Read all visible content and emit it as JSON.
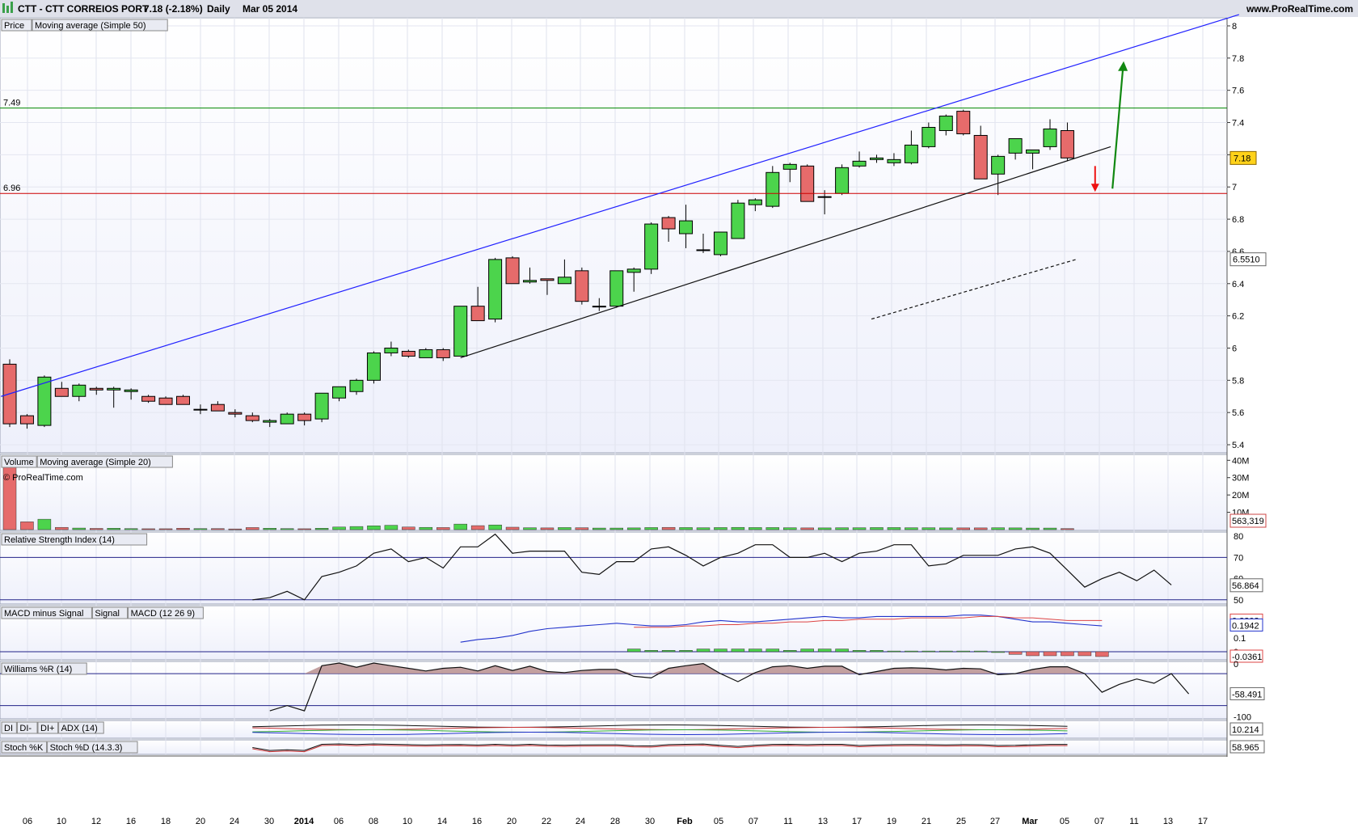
{
  "header": {
    "title": "CTT - CTT CORREIOS PORT",
    "quote": "7.18 (-2.18%)",
    "period": "Daily",
    "date": "Mar 05 2014",
    "site": "www.ProRealTime.com"
  },
  "watermark": "© ProRealTime.com",
  "colors": {
    "up": "#4cd44c",
    "down": "#e66b6b",
    "channel_upper": "#2020ff",
    "resistance": "#008800",
    "support_line": "#cc0000",
    "panel_bg": "#eef0fb"
  },
  "chart_data": [
    {
      "panel": "price",
      "type": "candlestick",
      "legend": [
        "Price",
        "Moving average (Simple 50)"
      ],
      "ylim": [
        5.38,
        8.02
      ],
      "y_ticks": [
        "5.4",
        "5.6",
        "5.8",
        "6",
        "6.2",
        "6.4",
        "6.6",
        "6.8",
        "7",
        "7.2",
        "7.4",
        "7.6",
        "7.8",
        "8"
      ],
      "last_price_label": "7.18",
      "ma_label": "6.5510",
      "levels": [
        {
          "label": "7.49",
          "value": 7.49,
          "color": "green"
        },
        {
          "label": "6.96",
          "value": 6.96,
          "color": "red"
        }
      ],
      "x_ticks": [
        "06",
        "10",
        "12",
        "16",
        "18",
        "20",
        "24",
        "30",
        "2014",
        "06",
        "08",
        "10",
        "14",
        "16",
        "20",
        "22",
        "24",
        "28",
        "30",
        "Feb",
        "05",
        "07",
        "11",
        "13",
        "17",
        "19",
        "21",
        "25",
        "27",
        "Mar",
        "05",
        "07",
        "11",
        "13",
        "17"
      ],
      "candles": [
        {
          "o": 5.9,
          "h": 5.93,
          "l": 5.51,
          "c": 5.53
        },
        {
          "o": 5.58,
          "h": 5.59,
          "l": 5.5,
          "c": 5.53
        },
        {
          "o": 5.52,
          "h": 5.83,
          "l": 5.51,
          "c": 5.82
        },
        {
          "o": 5.75,
          "h": 5.79,
          "l": 5.73,
          "c": 5.7
        },
        {
          "o": 5.7,
          "h": 5.78,
          "l": 5.67,
          "c": 5.77
        },
        {
          "o": 5.75,
          "h": 5.76,
          "l": 5.71,
          "c": 5.74
        },
        {
          "o": 5.74,
          "h": 5.76,
          "l": 5.63,
          "c": 5.75
        },
        {
          "o": 5.73,
          "h": 5.75,
          "l": 5.68,
          "c": 5.74
        },
        {
          "o": 5.7,
          "h": 5.71,
          "l": 5.66,
          "c": 5.67
        },
        {
          "o": 5.69,
          "h": 5.7,
          "l": 5.65,
          "c": 5.65
        },
        {
          "o": 5.7,
          "h": 5.71,
          "l": 5.65,
          "c": 5.65
        },
        {
          "o": 5.62,
          "h": 5.65,
          "l": 5.59,
          "c": 5.62
        },
        {
          "o": 5.65,
          "h": 5.67,
          "l": 5.61,
          "c": 5.61
        },
        {
          "o": 5.6,
          "h": 5.62,
          "l": 5.57,
          "c": 5.59
        },
        {
          "o": 5.58,
          "h": 5.6,
          "l": 5.54,
          "c": 5.55
        },
        {
          "o": 5.54,
          "h": 5.56,
          "l": 5.51,
          "c": 5.55
        },
        {
          "o": 5.53,
          "h": 5.6,
          "l": 5.53,
          "c": 5.59
        },
        {
          "o": 5.59,
          "h": 5.6,
          "l": 5.52,
          "c": 5.55
        },
        {
          "o": 5.56,
          "h": 5.72,
          "l": 5.54,
          "c": 5.72
        },
        {
          "o": 5.69,
          "h": 5.76,
          "l": 5.67,
          "c": 5.76
        },
        {
          "o": 5.73,
          "h": 5.81,
          "l": 5.71,
          "c": 5.8
        },
        {
          "o": 5.8,
          "h": 5.98,
          "l": 5.78,
          "c": 5.97
        },
        {
          "o": 5.97,
          "h": 6.04,
          "l": 5.95,
          "c": 6.0
        },
        {
          "o": 5.98,
          "h": 5.99,
          "l": 5.94,
          "c": 5.95
        },
        {
          "o": 5.94,
          "h": 6.0,
          "l": 5.94,
          "c": 5.99
        },
        {
          "o": 5.99,
          "h": 6.0,
          "l": 5.92,
          "c": 5.94
        },
        {
          "o": 5.95,
          "h": 6.26,
          "l": 5.95,
          "c": 6.26
        },
        {
          "o": 6.26,
          "h": 6.38,
          "l": 6.17,
          "c": 6.17
        },
        {
          "o": 6.18,
          "h": 6.56,
          "l": 6.16,
          "c": 6.55
        },
        {
          "o": 6.56,
          "h": 6.57,
          "l": 6.4,
          "c": 6.4
        },
        {
          "o": 6.41,
          "h": 6.5,
          "l": 6.4,
          "c": 6.42
        },
        {
          "o": 6.43,
          "h": 6.43,
          "l": 6.33,
          "c": 6.42
        },
        {
          "o": 6.4,
          "h": 6.55,
          "l": 6.4,
          "c": 6.44
        },
        {
          "o": 6.48,
          "h": 6.5,
          "l": 6.27,
          "c": 6.29
        },
        {
          "o": 6.26,
          "h": 6.31,
          "l": 6.23,
          "c": 6.26
        },
        {
          "o": 6.26,
          "h": 6.48,
          "l": 6.25,
          "c": 6.48
        },
        {
          "o": 6.47,
          "h": 6.5,
          "l": 6.35,
          "c": 6.49
        },
        {
          "o": 6.49,
          "h": 6.78,
          "l": 6.46,
          "c": 6.77
        },
        {
          "o": 6.81,
          "h": 6.82,
          "l": 6.66,
          "c": 6.74
        },
        {
          "o": 6.71,
          "h": 6.89,
          "l": 6.62,
          "c": 6.79
        },
        {
          "o": 6.61,
          "h": 6.71,
          "l": 6.59,
          "c": 6.61
        },
        {
          "o": 6.58,
          "h": 6.72,
          "l": 6.57,
          "c": 6.72
        },
        {
          "o": 6.68,
          "h": 6.92,
          "l": 6.68,
          "c": 6.9
        },
        {
          "o": 6.89,
          "h": 6.93,
          "l": 6.85,
          "c": 6.92
        },
        {
          "o": 6.88,
          "h": 7.13,
          "l": 6.87,
          "c": 7.09
        },
        {
          "o": 7.11,
          "h": 7.15,
          "l": 7.03,
          "c": 7.14
        },
        {
          "o": 7.13,
          "h": 7.14,
          "l": 6.91,
          "c": 6.91
        },
        {
          "o": 6.94,
          "h": 6.98,
          "l": 6.83,
          "c": 6.94
        },
        {
          "o": 6.96,
          "h": 7.14,
          "l": 6.95,
          "c": 7.12
        },
        {
          "o": 7.13,
          "h": 7.22,
          "l": 7.12,
          "c": 7.16
        },
        {
          "o": 7.17,
          "h": 7.2,
          "l": 7.15,
          "c": 7.18
        },
        {
          "o": 7.15,
          "h": 7.21,
          "l": 7.13,
          "c": 7.17
        },
        {
          "o": 7.15,
          "h": 7.35,
          "l": 7.14,
          "c": 7.26
        },
        {
          "o": 7.25,
          "h": 7.4,
          "l": 7.24,
          "c": 7.37
        },
        {
          "o": 7.35,
          "h": 7.45,
          "l": 7.32,
          "c": 7.44
        },
        {
          "o": 7.47,
          "h": 7.48,
          "l": 7.32,
          "c": 7.33
        },
        {
          "o": 7.32,
          "h": 7.38,
          "l": 7.05,
          "c": 7.05
        },
        {
          "o": 7.08,
          "h": 7.2,
          "l": 6.95,
          "c": 7.19
        },
        {
          "o": 7.21,
          "h": 7.3,
          "l": 7.17,
          "c": 7.3
        },
        {
          "o": 7.21,
          "h": 7.23,
          "l": 7.11,
          "c": 7.23
        },
        {
          "o": 7.25,
          "h": 7.42,
          "l": 7.23,
          "c": 7.36
        },
        {
          "o": 7.35,
          "h": 7.4,
          "l": 7.16,
          "c": 7.18
        }
      ],
      "annotations": [
        {
          "type": "channel-upper",
          "from": [
            -0.5,
            5.7
          ],
          "to": [
            70.9,
            8.07
          ]
        },
        {
          "type": "channel-lower",
          "from": [
            26,
            5.94
          ],
          "to": [
            63.5,
            7.25
          ]
        },
        {
          "type": "projection-dashed",
          "from": [
            49.7,
            6.18
          ],
          "to": [
            61.5,
            6.55
          ]
        },
        {
          "type": "arrow-down",
          "from": [
            62.6,
            7.13
          ],
          "to": [
            62.6,
            6.98
          ]
        },
        {
          "type": "arrow-up",
          "from": [
            63.6,
            6.99
          ],
          "to": [
            64.2,
            7.77
          ]
        }
      ]
    },
    {
      "panel": "volume",
      "type": "bar",
      "legend": [
        "Volume",
        "Moving average (Simple 20)"
      ],
      "ylim": [
        0,
        42
      ],
      "y_ticks": [
        "40M",
        "30M",
        "20M",
        "10M"
      ],
      "last_label": "563,319",
      "values": [
        40,
        4.5,
        6,
        1.3,
        0.9,
        0.7,
        0.8,
        0.6,
        0.5,
        0.5,
        0.8,
        0.6,
        0.6,
        0.4,
        1.2,
        0.8,
        0.6,
        0.5,
        0.8,
        1.5,
        1.8,
        2.2,
        2.5,
        1.5,
        1.3,
        1.2,
        3.2,
        2.3,
        2.7,
        1.4,
        1.1,
        1.0,
        1.2,
        1.1,
        0.9,
        0.9,
        1.0,
        1.2,
        1.3,
        1.2,
        1.1,
        1.2,
        1.3,
        1.2,
        1.2,
        1.1,
        1.0,
        1.0,
        1.1,
        1.1,
        1.2,
        1.2,
        1.1,
        1.1,
        1.0,
        1.0,
        1.0,
        1.1,
        1.0,
        0.9,
        0.9,
        0.6
      ]
    },
    {
      "panel": "rsi",
      "type": "line",
      "legend": [
        "Relative Strength Index (14)"
      ],
      "ylim": [
        48,
        82
      ],
      "y_ticks": [
        "80",
        "70",
        "60",
        "50"
      ],
      "levels": [
        70,
        50
      ],
      "last_label": "56.864",
      "start_index": 14,
      "values": [
        50,
        51,
        54,
        50,
        61,
        63,
        66,
        72,
        74,
        68,
        70,
        65,
        75,
        75,
        81,
        72,
        73,
        73,
        73,
        63,
        62,
        68,
        68,
        74,
        75,
        71,
        66,
        70,
        72,
        76,
        76,
        70,
        70,
        72,
        68,
        72,
        73,
        76,
        76,
        66,
        67,
        71,
        71,
        71,
        74,
        75,
        72,
        64,
        56,
        60,
        63,
        59,
        64,
        57
      ]
    },
    {
      "panel": "macd",
      "type": "line",
      "legend": [
        "MACD minus Signal",
        "Signal",
        "MACD (12 26 9)"
      ],
      "ylim": [
        -0.06,
        0.34
      ],
      "y_ticks": [
        "0.1",
        "0"
      ],
      "last_labels": [
        "0.2303",
        "0.1942",
        "-0.0361"
      ],
      "start_index": 26,
      "macd": [
        0.07,
        0.09,
        0.1,
        0.12,
        0.15,
        0.17,
        0.18,
        0.19,
        0.2,
        0.21,
        0.2,
        0.19,
        0.19,
        0.2,
        0.22,
        0.23,
        0.22,
        0.22,
        0.23,
        0.24,
        0.25,
        0.26,
        0.25,
        0.25,
        0.26,
        0.26,
        0.26,
        0.26,
        0.26,
        0.27,
        0.27,
        0.26,
        0.24,
        0.22,
        0.22,
        0.21,
        0.2,
        0.19
      ],
      "signal": [
        null,
        null,
        null,
        null,
        null,
        null,
        null,
        null,
        null,
        null,
        0.18,
        0.18,
        0.18,
        0.19,
        0.19,
        0.2,
        0.2,
        0.21,
        0.21,
        0.22,
        0.22,
        0.23,
        0.23,
        0.24,
        0.24,
        0.24,
        0.25,
        0.25,
        0.25,
        0.25,
        0.26,
        0.26,
        0.25,
        0.25,
        0.24,
        0.23,
        0.23,
        0.23
      ],
      "hist": [
        null,
        null,
        null,
        null,
        null,
        null,
        null,
        null,
        null,
        null,
        0.02,
        0.01,
        0.01,
        0.01,
        0.02,
        0.02,
        0.02,
        0.02,
        0.02,
        0.01,
        0.02,
        0.02,
        0.02,
        0.01,
        0.01,
        0.005,
        0.005,
        0.005,
        0.005,
        0.005,
        0.005,
        0.0,
        -0.02,
        -0.03,
        -0.03,
        -0.03,
        -0.03,
        -0.036
      ]
    },
    {
      "panel": "williams",
      "type": "line",
      "legend": [
        "Williams %R (14)"
      ],
      "ylim": [
        -105,
        3
      ],
      "y_ticks": [
        "0",
        "-100"
      ],
      "levels": [
        -20,
        -80
      ],
      "last_label": "-58.491",
      "start_index": 15,
      "values": [
        -90,
        -80,
        -90,
        -5,
        0,
        -8,
        0,
        -5,
        -10,
        -15,
        -10,
        -8,
        -15,
        -5,
        -14,
        -6,
        -16,
        -18,
        -14,
        -12,
        -12,
        -25,
        -28,
        -10,
        -5,
        -1,
        -20,
        -35,
        -18,
        -7,
        -5,
        -10,
        -6,
        -6,
        -22,
        -16,
        -10,
        -9,
        -10,
        -13,
        -10,
        -11,
        -22,
        -20,
        -12,
        -7,
        -7,
        -20,
        -55,
        -40,
        -30,
        -38,
        -20,
        -58
      ]
    },
    {
      "panel": "adx",
      "type": "line",
      "legend": [
        "DI",
        "DI-",
        "DI+",
        "ADX (14)"
      ],
      "last_label": "10.214",
      "y_ticks": []
    },
    {
      "panel": "stochastic",
      "type": "line",
      "legend": [
        "Stoch %K",
        "Stoch %D (14.3.3)"
      ],
      "last_label": "58.965",
      "y_ticks": []
    }
  ]
}
